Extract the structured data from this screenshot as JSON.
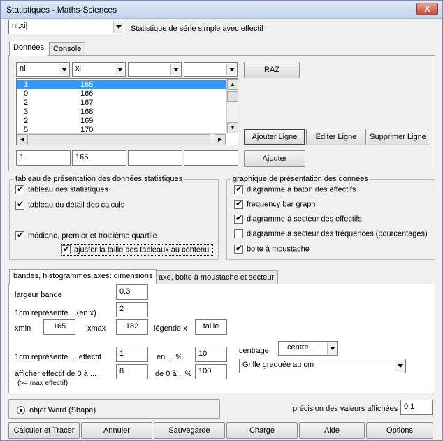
{
  "window": {
    "title": "Statistiques - Maths-Sciences",
    "close": "X"
  },
  "mode": {
    "value": "ni;xi|",
    "description": "Statistique de série simple avec effectif"
  },
  "top_tabs": [
    "Données",
    "Console"
  ],
  "columns": [
    "ni",
    "xi",
    "",
    ""
  ],
  "list_rows": [
    {
      "ni": "1",
      "xi": "165"
    },
    {
      "ni": "0",
      "xi": "166"
    },
    {
      "ni": "2",
      "xi": "167"
    },
    {
      "ni": "3",
      "xi": "168"
    },
    {
      "ni": "2",
      "xi": "169"
    },
    {
      "ni": "5",
      "xi": "170"
    }
  ],
  "buttons": {
    "raz": "RAZ",
    "add_line": "Ajouter Ligne",
    "edit_line": "Editer Ligne",
    "delete_line": "Supprimer Ligne",
    "add": "Ajouter"
  },
  "entry": [
    "1",
    "165",
    "",
    ""
  ],
  "tables_frame": {
    "legend": "tableau de présentation des données statistiques",
    "items": [
      {
        "label": "tableau des statistiques",
        "checked": true
      },
      {
        "label": "tableau du détail des calculs",
        "checked": true
      },
      {
        "label": "médiane, premier et troisième quartile",
        "checked": true
      },
      {
        "label": "ajuster la taille des tableaux au contenu",
        "checked": true
      }
    ]
  },
  "graph_frame": {
    "legend": "graphique de présentation des données",
    "items": [
      {
        "label": "diagramme à baton des effectifs",
        "checked": true
      },
      {
        "label": "frequency bar graph",
        "checked": true
      },
      {
        "label": "diagramme à secteur des effectifs",
        "checked": true
      },
      {
        "label": "diagramme à secteur des fréquences (pourcentages)",
        "checked": false
      },
      {
        "label": "boite à moustache",
        "checked": true
      }
    ]
  },
  "lower_tabs": [
    "bandes, histogrammes,axes: dimensions",
    "axe, boite à moustache et secteur"
  ],
  "params": {
    "band_width_label": "largeur bande",
    "band_width": "0,3",
    "cm_x_label": "1cm représente ...(en x)",
    "cm_x": "2",
    "xmin_label": "xmin",
    "xmin": "165",
    "xmax_label": "xmax",
    "xmax": "182",
    "legend_x_label": "légende x",
    "legend_x": "taille",
    "cm_eff_label": "1cm représente ... effectif",
    "cm_eff": "1",
    "en_pct_label": "en ... %",
    "en_pct": "10",
    "show_eff_label": "afficher effectif de 0 à ...",
    "show_eff_note": "(>= max effectif)",
    "show_eff": "8",
    "de0_label": "de 0 à ...%",
    "de0": "100",
    "centrage_label": "centrage",
    "centrage": "centre",
    "grid": "Grille graduée au cm"
  },
  "output": {
    "word_shape": "objet Word (Shape)"
  },
  "precision": {
    "label": "précision des valeurs affichées",
    "value": "0,1"
  },
  "bottom_buttons": [
    "Calculer et Tracer",
    "Annuler",
    "Sauvegarde",
    "Charge",
    "Aide",
    "Options"
  ]
}
